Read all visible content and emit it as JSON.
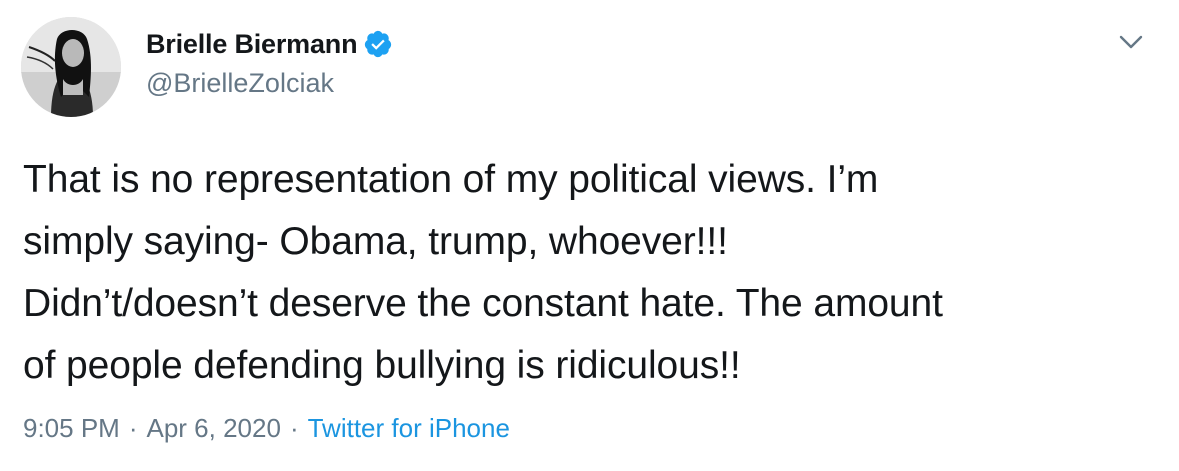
{
  "tweet": {
    "author": {
      "display_name": "Brielle Biermann",
      "handle": "@BrielleZolciak",
      "verified": true,
      "verified_color": "#1da1f2"
    },
    "text": "That is no representation of my political views. I’m\nsimply saying- Obama, trump, whoever!!!\nDidn’t/doesn’t deserve the constant hate. The amount\nof people defending bullying is ridiculous!!",
    "time": "9:05 PM",
    "separator": "·",
    "date": "Apr 6, 2020",
    "source": "Twitter for iPhone",
    "icons": {
      "verified": "verified-badge-icon",
      "menu": "chevron-down-icon"
    },
    "colors": {
      "text": "#14171a",
      "secondary": "#657786",
      "link": "#1b95e0"
    }
  }
}
